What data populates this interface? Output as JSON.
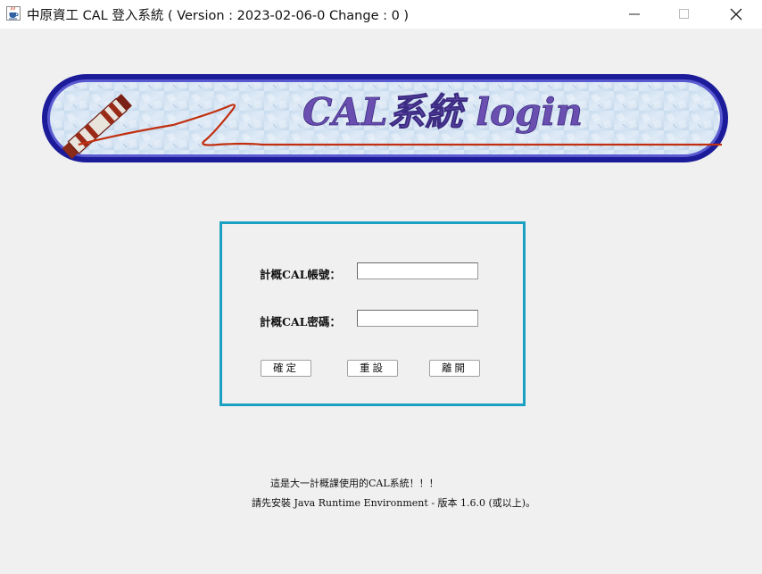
{
  "window": {
    "title": "中原資工 CAL 登入系統 ( Version : 2023-02-06-0 Change : 0 )"
  },
  "banner": {
    "text": "CAL系統 login"
  },
  "login": {
    "account_label": "計概CAL帳號：",
    "password_label": "計概CAL密碼：",
    "account_value": "",
    "password_value": "",
    "confirm_label": "確定",
    "reset_label": "重設",
    "leave_label": "離開"
  },
  "footer": {
    "line1": "這是大一計概課使用的CAL系統！！！",
    "line2": "請先安裝 Java Runtime Environment - 版本 1.6.0 (或以上)。"
  },
  "colors": {
    "panel_border": "#1aa0c0",
    "banner_border": "#1c1c9a",
    "banner_text": "#6a4fb0",
    "banner_line": "#c03010"
  }
}
